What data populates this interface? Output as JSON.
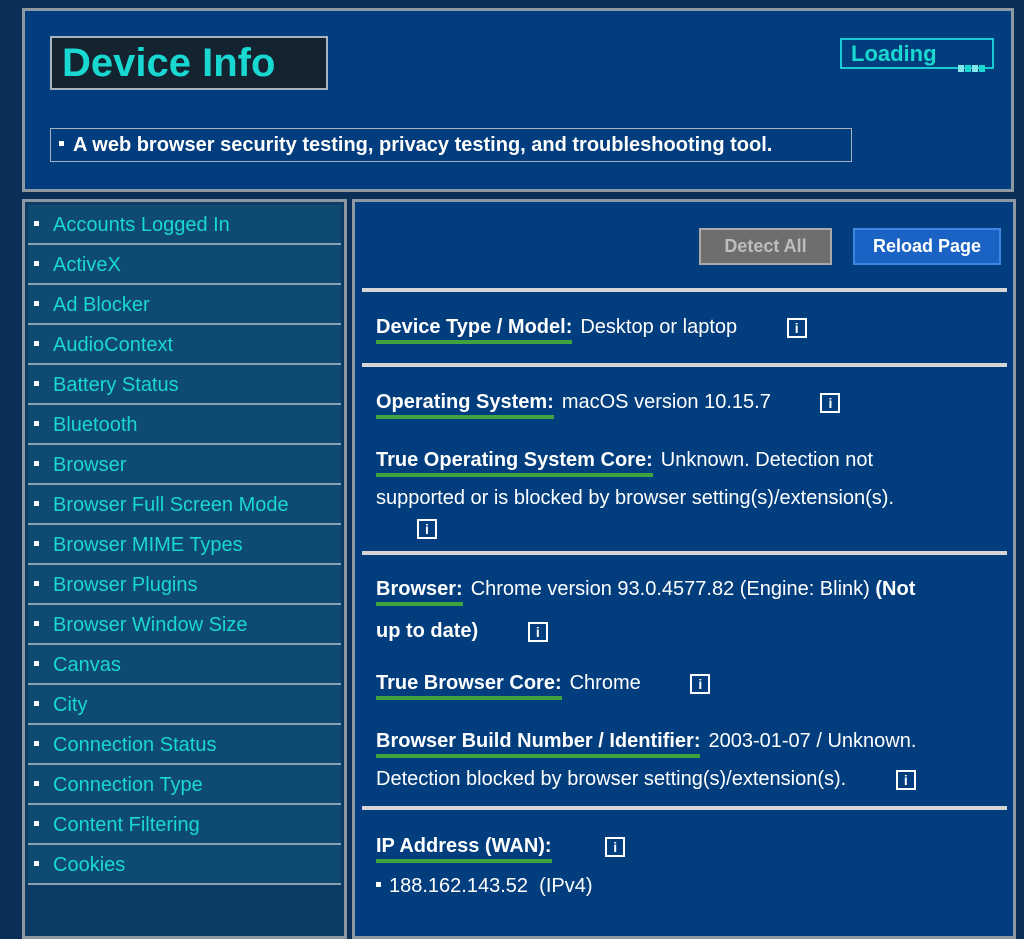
{
  "header": {
    "title": "Device Info",
    "loading_label": "Loading",
    "tagline": "A web browser security testing, privacy testing, and troubleshooting tool."
  },
  "sidebar": {
    "items": [
      {
        "label": "Accounts Logged In"
      },
      {
        "label": "ActiveX"
      },
      {
        "label": "Ad Blocker"
      },
      {
        "label": "AudioContext"
      },
      {
        "label": "Battery Status"
      },
      {
        "label": "Bluetooth"
      },
      {
        "label": "Browser"
      },
      {
        "label": "Browser Full Screen Mode"
      },
      {
        "label": "Browser MIME Types"
      },
      {
        "label": "Browser Plugins"
      },
      {
        "label": "Browser Window Size"
      },
      {
        "label": "Canvas"
      },
      {
        "label": "City"
      },
      {
        "label": "Connection Status"
      },
      {
        "label": "Connection Type"
      },
      {
        "label": "Content Filtering"
      },
      {
        "label": "Cookies"
      }
    ]
  },
  "toolbar": {
    "detect_all_label": "Detect All",
    "reload_label": "Reload Page"
  },
  "info_icon_glyph": "i",
  "fields": {
    "device_type": {
      "label": "Device Type / Model:",
      "value": "Desktop or laptop"
    },
    "os": {
      "label": "Operating System:",
      "value": "macOS version 10.15.7"
    },
    "true_os": {
      "label": "True Operating System Core:",
      "value_line1": "Unknown. Detection not",
      "value_line2": "supported or is blocked by browser setting(s)/extension(s)."
    },
    "browser": {
      "label": "Browser:",
      "value": "Chrome version 93.0.4577.82 (Engine: Blink)",
      "status_line1": "(Not",
      "status_line2": "up to date)"
    },
    "true_browser": {
      "label": "True Browser Core:",
      "value": "Chrome"
    },
    "build": {
      "label": "Browser Build Number / Identifier:",
      "value_line1": "2003-01-07 / Unknown.",
      "value_line2": "Detection blocked by browser setting(s)/extension(s)."
    },
    "ip": {
      "label": "IP Address (WAN):",
      "value": "188.162.143.52",
      "version": "(IPv4)"
    }
  },
  "colors": {
    "accent_cyan": "#19d7d1",
    "label_underline": "#3fa33f",
    "reload_button": "#1a63c4",
    "panel_bg": "#023e7d"
  }
}
